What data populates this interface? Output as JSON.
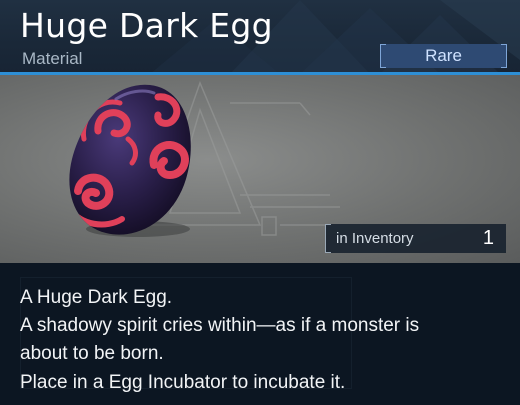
{
  "item": {
    "name": "Huge Dark Egg",
    "category": "Material",
    "rarity": "Rare"
  },
  "inventory": {
    "label": "in Inventory",
    "count": "1"
  },
  "description": [
    "A Huge Dark Egg.",
    "A shadowy spirit cries within—as if a monster is",
    "about to be born.",
    "Place in a Egg Incubator to incubate it."
  ],
  "colors": {
    "accent": "#2d8fd6",
    "rarity_bg": "#2e4a73",
    "egg_body": "#2a1f4a",
    "egg_pattern": "#e0405a"
  },
  "icons": [
    "egg-icon"
  ]
}
